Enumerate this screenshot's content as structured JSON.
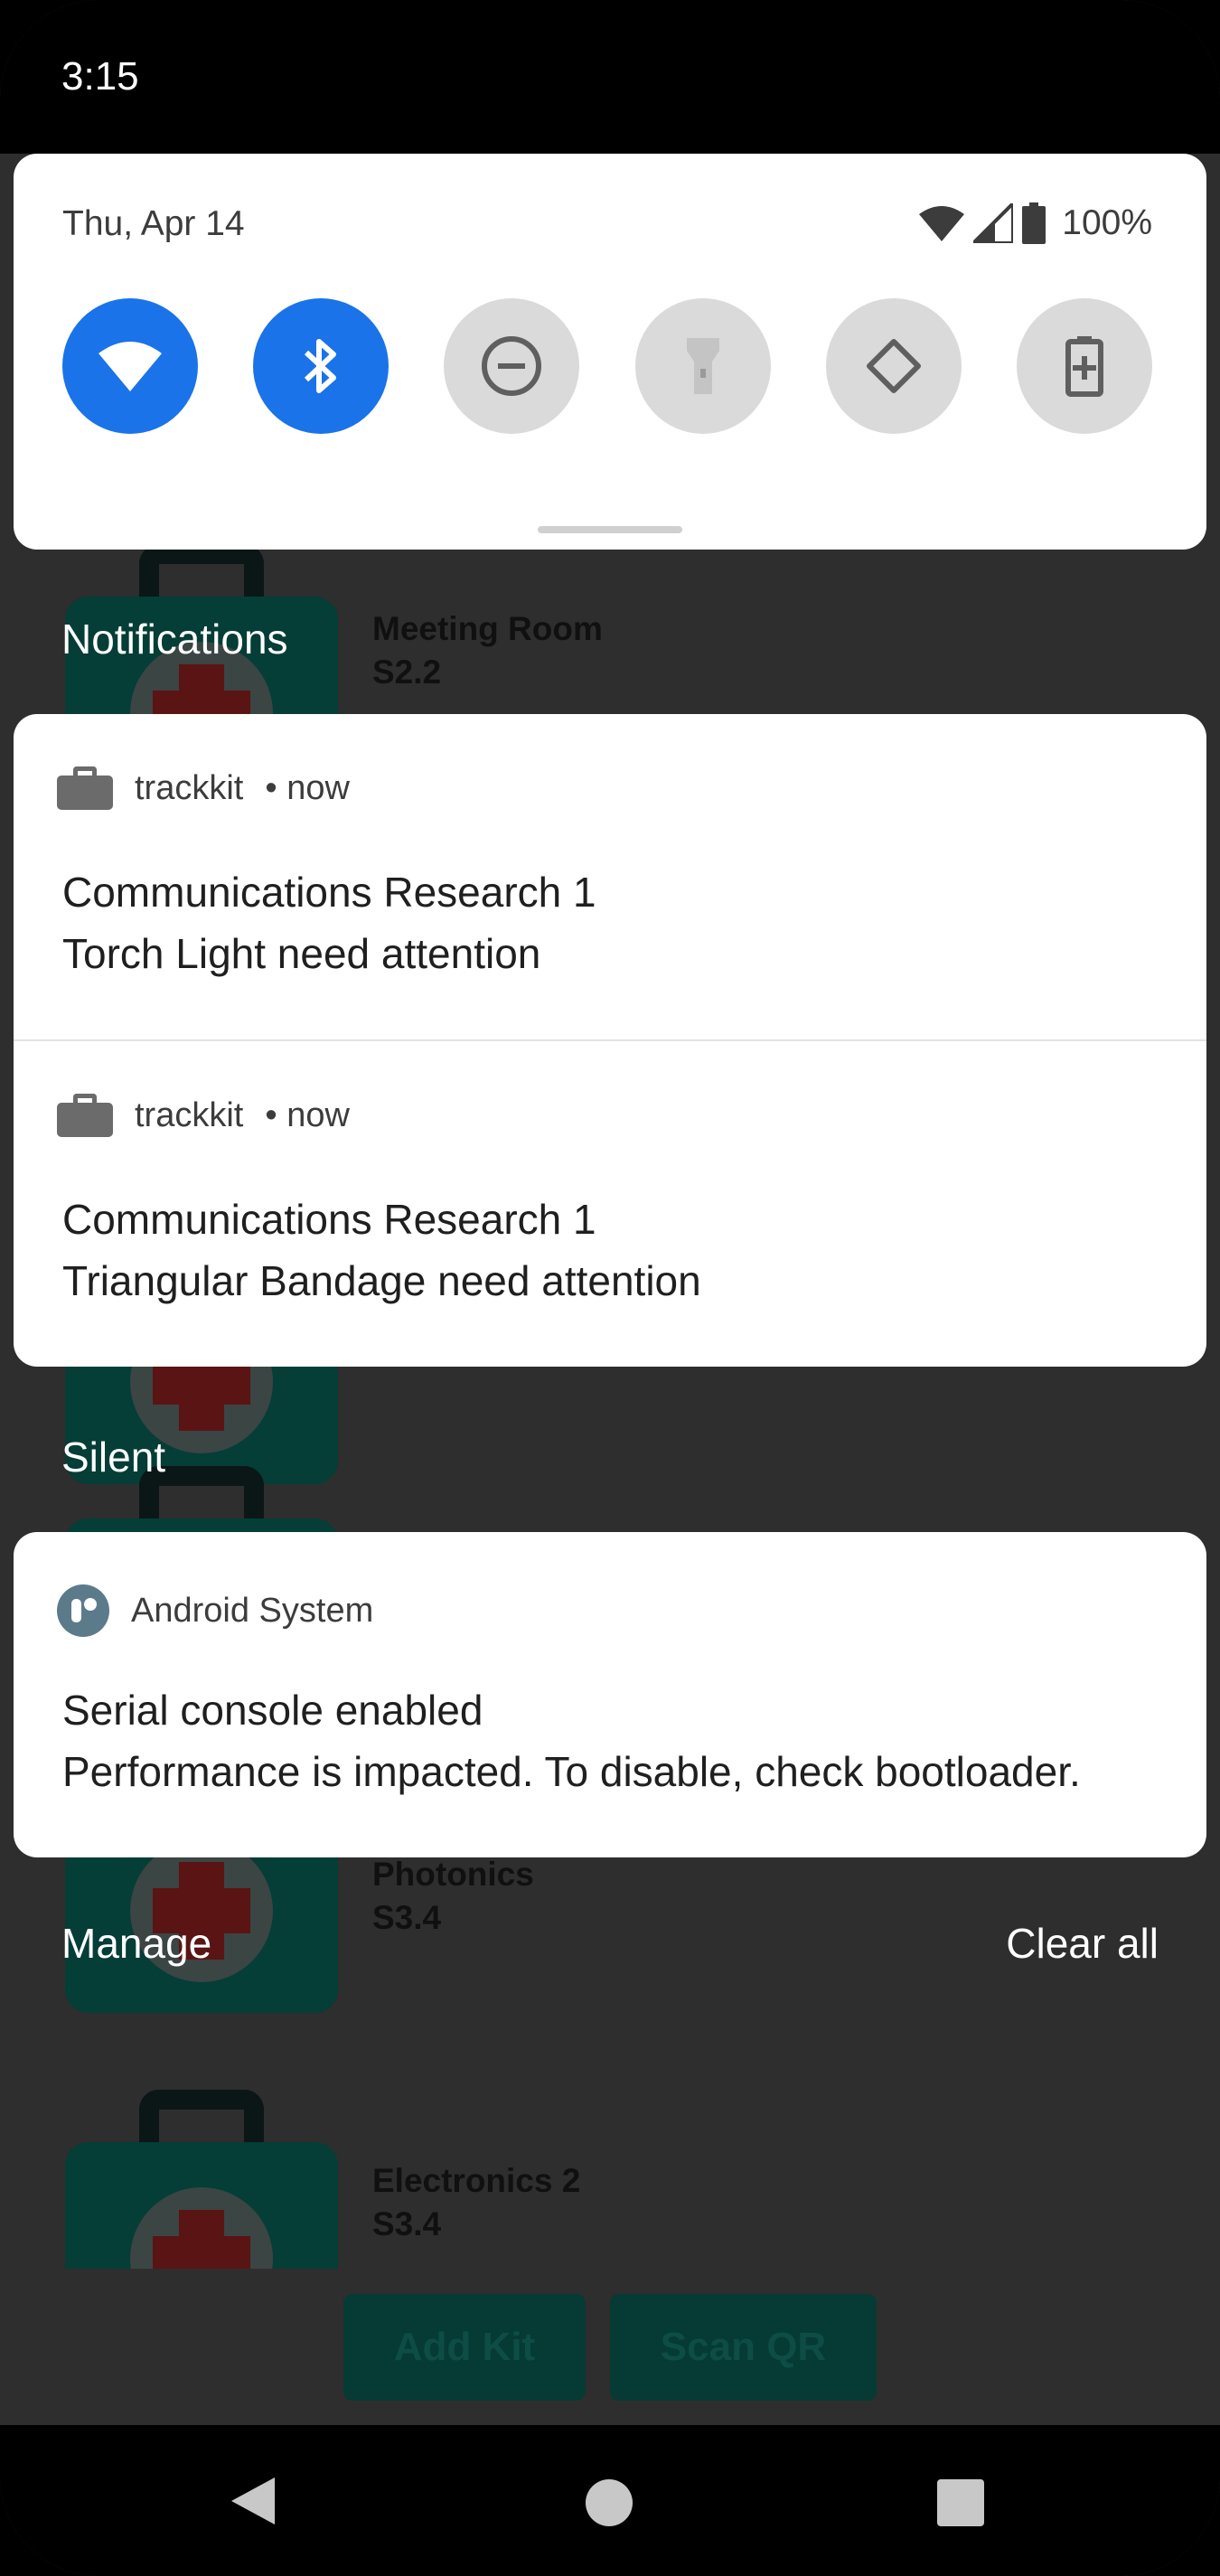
{
  "status_bar": {
    "time": "3:15"
  },
  "quick_settings": {
    "date": "Thu, Apr 14",
    "battery": "100%",
    "tiles": [
      {
        "name": "wifi",
        "state": "on"
      },
      {
        "name": "bluetooth",
        "state": "on"
      },
      {
        "name": "do-not-disturb",
        "state": "off"
      },
      {
        "name": "flashlight",
        "state": "off"
      },
      {
        "name": "auto-rotate",
        "state": "off"
      },
      {
        "name": "battery-saver",
        "state": "off"
      }
    ]
  },
  "sections": {
    "notifications": "Notifications",
    "silent": "Silent"
  },
  "notifications": [
    {
      "app": "trackkit",
      "time": "• now",
      "title": "Communications Research 1",
      "text": "Torch Light need attention"
    },
    {
      "app": "trackkit",
      "time": "• now",
      "title": "Communications Research 1",
      "text": "Triangular Bandage need attention"
    }
  ],
  "silent_notifications": [
    {
      "app": "Android System",
      "title": "Serial console enabled",
      "text": "Performance is impacted. To disable, check bootloader."
    }
  ],
  "actions": {
    "manage": "Manage",
    "clear_all": "Clear all"
  },
  "background_app": {
    "kits": [
      {
        "name": "Meeting Room",
        "location": "S2.2"
      },
      {
        "name": "Photonics",
        "location": "S3.4"
      },
      {
        "name": "Electronics 2",
        "location": "S3.4"
      }
    ],
    "buttons": {
      "add_kit": "Add Kit",
      "scan_qr": "Scan QR"
    }
  },
  "colors": {
    "accent": "#1a73e8",
    "tile_off": "#dadada",
    "scrim": "#2d2e2d"
  }
}
